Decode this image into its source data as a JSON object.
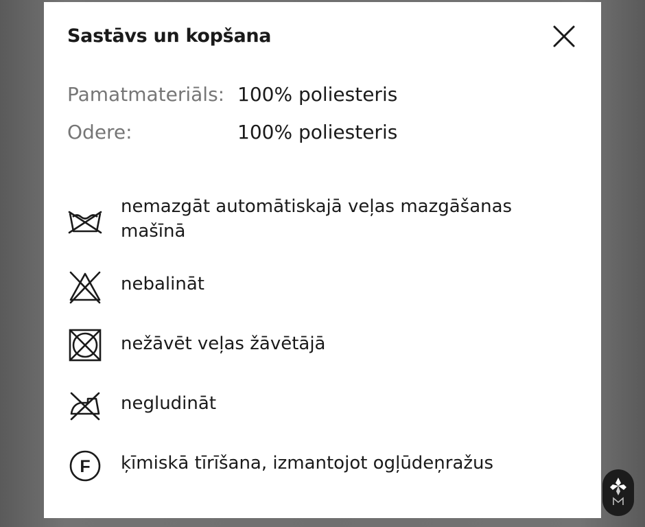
{
  "modal": {
    "title": "Sastāvs un kopšana",
    "close_icon": "close-icon"
  },
  "composition": [
    {
      "label": "Pamatmateriāls:",
      "value": "100% poliesteris"
    },
    {
      "label": "Odere:",
      "value": "100% poliesteris"
    }
  ],
  "care": [
    {
      "icon": "no-machine-wash-icon",
      "text": "nemazgāt automātiskajā veļas mazgāšanas mašīnā"
    },
    {
      "icon": "no-bleach-icon",
      "text": "nebalināt"
    },
    {
      "icon": "no-tumble-dry-icon",
      "text": "nežāvēt veļas žāvētājā"
    },
    {
      "icon": "no-iron-icon",
      "text": "negludināt"
    },
    {
      "icon": "dry-clean-f-icon",
      "text": "ķīmiskā tīrīšana, izmantojot ogļūdeņražus",
      "symbol": "F"
    }
  ],
  "colors": {
    "backdrop": "#6a6a6a",
    "modal_bg": "#ffffff",
    "text_primary": "#1a1a1a",
    "text_secondary": "#767676"
  }
}
